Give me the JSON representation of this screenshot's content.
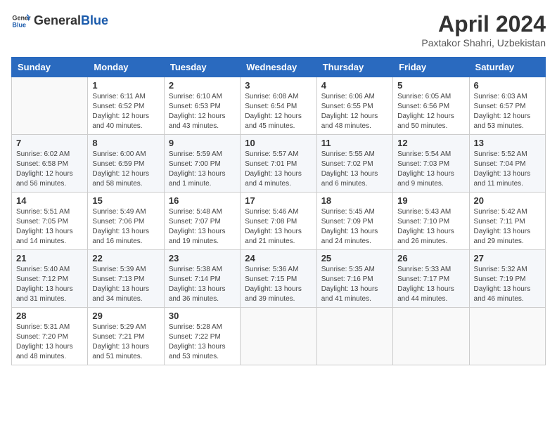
{
  "header": {
    "logo_general": "General",
    "logo_blue": "Blue",
    "title": "April 2024",
    "subtitle": "Paxtakor Shahri, Uzbekistan"
  },
  "columns": [
    "Sunday",
    "Monday",
    "Tuesday",
    "Wednesday",
    "Thursday",
    "Friday",
    "Saturday"
  ],
  "weeks": [
    [
      {
        "day": "",
        "info": ""
      },
      {
        "day": "1",
        "info": "Sunrise: 6:11 AM\nSunset: 6:52 PM\nDaylight: 12 hours\nand 40 minutes."
      },
      {
        "day": "2",
        "info": "Sunrise: 6:10 AM\nSunset: 6:53 PM\nDaylight: 12 hours\nand 43 minutes."
      },
      {
        "day": "3",
        "info": "Sunrise: 6:08 AM\nSunset: 6:54 PM\nDaylight: 12 hours\nand 45 minutes."
      },
      {
        "day": "4",
        "info": "Sunrise: 6:06 AM\nSunset: 6:55 PM\nDaylight: 12 hours\nand 48 minutes."
      },
      {
        "day": "5",
        "info": "Sunrise: 6:05 AM\nSunset: 6:56 PM\nDaylight: 12 hours\nand 50 minutes."
      },
      {
        "day": "6",
        "info": "Sunrise: 6:03 AM\nSunset: 6:57 PM\nDaylight: 12 hours\nand 53 minutes."
      }
    ],
    [
      {
        "day": "7",
        "info": "Sunrise: 6:02 AM\nSunset: 6:58 PM\nDaylight: 12 hours\nand 56 minutes."
      },
      {
        "day": "8",
        "info": "Sunrise: 6:00 AM\nSunset: 6:59 PM\nDaylight: 12 hours\nand 58 minutes."
      },
      {
        "day": "9",
        "info": "Sunrise: 5:59 AM\nSunset: 7:00 PM\nDaylight: 13 hours\nand 1 minute."
      },
      {
        "day": "10",
        "info": "Sunrise: 5:57 AM\nSunset: 7:01 PM\nDaylight: 13 hours\nand 4 minutes."
      },
      {
        "day": "11",
        "info": "Sunrise: 5:55 AM\nSunset: 7:02 PM\nDaylight: 13 hours\nand 6 minutes."
      },
      {
        "day": "12",
        "info": "Sunrise: 5:54 AM\nSunset: 7:03 PM\nDaylight: 13 hours\nand 9 minutes."
      },
      {
        "day": "13",
        "info": "Sunrise: 5:52 AM\nSunset: 7:04 PM\nDaylight: 13 hours\nand 11 minutes."
      }
    ],
    [
      {
        "day": "14",
        "info": "Sunrise: 5:51 AM\nSunset: 7:05 PM\nDaylight: 13 hours\nand 14 minutes."
      },
      {
        "day": "15",
        "info": "Sunrise: 5:49 AM\nSunset: 7:06 PM\nDaylight: 13 hours\nand 16 minutes."
      },
      {
        "day": "16",
        "info": "Sunrise: 5:48 AM\nSunset: 7:07 PM\nDaylight: 13 hours\nand 19 minutes."
      },
      {
        "day": "17",
        "info": "Sunrise: 5:46 AM\nSunset: 7:08 PM\nDaylight: 13 hours\nand 21 minutes."
      },
      {
        "day": "18",
        "info": "Sunrise: 5:45 AM\nSunset: 7:09 PM\nDaylight: 13 hours\nand 24 minutes."
      },
      {
        "day": "19",
        "info": "Sunrise: 5:43 AM\nSunset: 7:10 PM\nDaylight: 13 hours\nand 26 minutes."
      },
      {
        "day": "20",
        "info": "Sunrise: 5:42 AM\nSunset: 7:11 PM\nDaylight: 13 hours\nand 29 minutes."
      }
    ],
    [
      {
        "day": "21",
        "info": "Sunrise: 5:40 AM\nSunset: 7:12 PM\nDaylight: 13 hours\nand 31 minutes."
      },
      {
        "day": "22",
        "info": "Sunrise: 5:39 AM\nSunset: 7:13 PM\nDaylight: 13 hours\nand 34 minutes."
      },
      {
        "day": "23",
        "info": "Sunrise: 5:38 AM\nSunset: 7:14 PM\nDaylight: 13 hours\nand 36 minutes."
      },
      {
        "day": "24",
        "info": "Sunrise: 5:36 AM\nSunset: 7:15 PM\nDaylight: 13 hours\nand 39 minutes."
      },
      {
        "day": "25",
        "info": "Sunrise: 5:35 AM\nSunset: 7:16 PM\nDaylight: 13 hours\nand 41 minutes."
      },
      {
        "day": "26",
        "info": "Sunrise: 5:33 AM\nSunset: 7:17 PM\nDaylight: 13 hours\nand 44 minutes."
      },
      {
        "day": "27",
        "info": "Sunrise: 5:32 AM\nSunset: 7:19 PM\nDaylight: 13 hours\nand 46 minutes."
      }
    ],
    [
      {
        "day": "28",
        "info": "Sunrise: 5:31 AM\nSunset: 7:20 PM\nDaylight: 13 hours\nand 48 minutes."
      },
      {
        "day": "29",
        "info": "Sunrise: 5:29 AM\nSunset: 7:21 PM\nDaylight: 13 hours\nand 51 minutes."
      },
      {
        "day": "30",
        "info": "Sunrise: 5:28 AM\nSunset: 7:22 PM\nDaylight: 13 hours\nand 53 minutes."
      },
      {
        "day": "",
        "info": ""
      },
      {
        "day": "",
        "info": ""
      },
      {
        "day": "",
        "info": ""
      },
      {
        "day": "",
        "info": ""
      }
    ]
  ]
}
